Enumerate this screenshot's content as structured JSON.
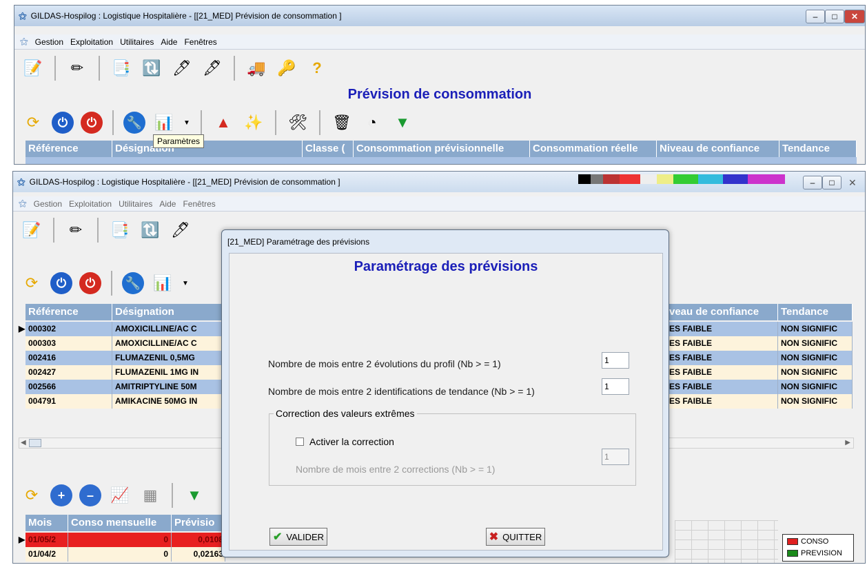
{
  "back_window": {
    "title": "GILDAS-Hospilog : Logistique Hospitalière - [[21_MED] Prévision de consommation ]",
    "menu": [
      "Gestion",
      "Exploitation",
      "Utilitaires",
      "Aide",
      "Fenêtres"
    ],
    "heading": "Prévision de consommation",
    "tooltip": "Paramètres",
    "columns": [
      "Référence",
      "Désignation",
      "Classe (",
      "Consommation prévisionnelle",
      "Consommation réelle",
      "Niveau de confiance",
      "Tendance"
    ]
  },
  "front_window": {
    "title": "GILDAS-Hospilog : Logistique Hospitalière - [[21_MED] Prévision de consommation ]",
    "menu": [
      "Gestion",
      "Exploitation",
      "Utilitaires",
      "Aide",
      "Fenêtres"
    ],
    "columns": [
      "Référence",
      "Désignation",
      "veau de confiance",
      "Tendance"
    ],
    "rows": [
      {
        "ref": "000302",
        "designation": "AMOXICILLINE/AC C",
        "confiance": "ES FAIBLE",
        "tendance": "NON SIGNIFIC"
      },
      {
        "ref": "000303",
        "designation": "AMOXICILLINE/AC C",
        "confiance": "ES FAIBLE",
        "tendance": "NON SIGNIFIC"
      },
      {
        "ref": "002416",
        "designation": "FLUMAZENIL 0,5MG",
        "confiance": "ES FAIBLE",
        "tendance": "NON SIGNIFIC"
      },
      {
        "ref": "002427",
        "designation": "FLUMAZENIL 1MG IN",
        "confiance": "ES FAIBLE",
        "tendance": "NON SIGNIFIC"
      },
      {
        "ref": "002566",
        "designation": "AMITRIPTYLINE 50M",
        "confiance": "ES FAIBLE",
        "tendance": "NON SIGNIFIC"
      },
      {
        "ref": "004791",
        "designation": "AMIKACINE 50MG IN",
        "confiance": "ES FAIBLE",
        "tendance": "NON SIGNIFIC"
      }
    ],
    "bottom_columns": [
      "Mois",
      "Conso mensuelle",
      "Prévisio"
    ],
    "bottom_rows": [
      {
        "mois": "01/05/2",
        "conso": "0",
        "prev": "0,0108"
      },
      {
        "mois": "01/04/2",
        "conso": "0",
        "prev": "0,02163"
      }
    ],
    "legend": {
      "conso": "CONSO",
      "prevision": "PREVISION"
    },
    "colors": {
      "conso": "#e02020",
      "prevision": "#1a8a1a"
    }
  },
  "dialog": {
    "title": "[21_MED] Paramétrage des prévisions",
    "heading": "Paramétrage des prévisions",
    "field1_label": "Nombre de mois entre 2  évolutions du profil  (Nb > = 1)",
    "field1_value": "1",
    "field2_label": "Nombre de mois entre 2  identifications de tendance  (Nb > = 1)",
    "field2_value": "1",
    "group_label": "Correction des valeurs extrêmes",
    "checkbox_label": "Activer la correction",
    "field3_label": "Nombre de mois entre 2  corrections  (Nb > = 1)",
    "field3_value": "1",
    "validate_label": "VALIDER",
    "quit_label": "QUITTER"
  }
}
